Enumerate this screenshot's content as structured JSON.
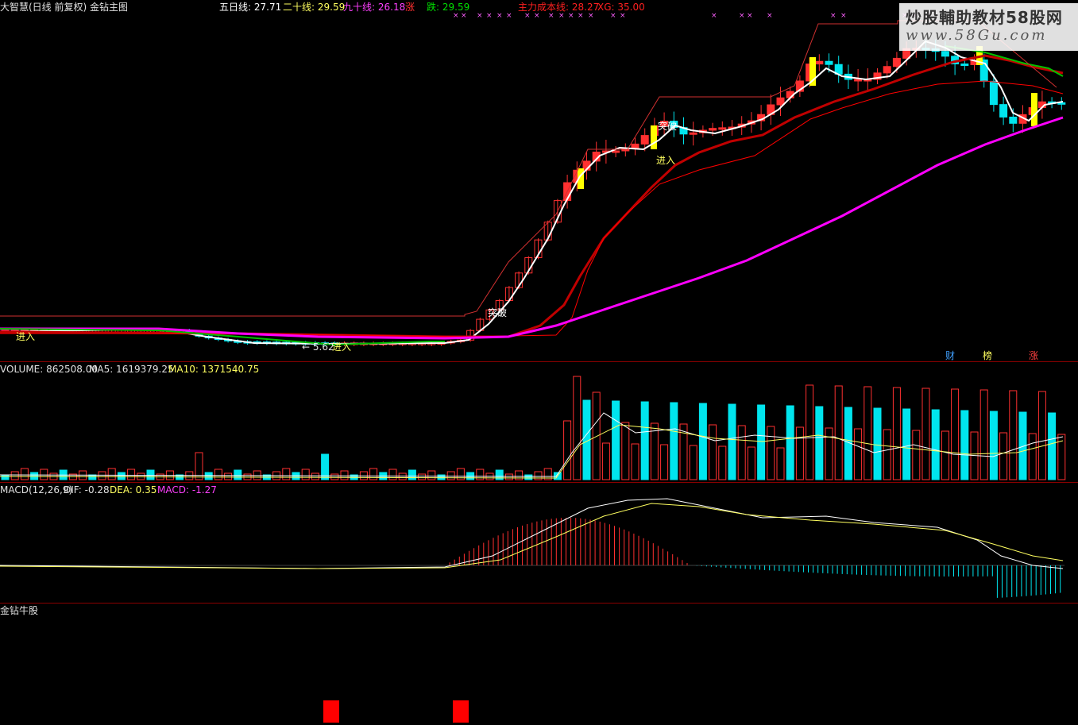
{
  "header": {
    "title": "大智慧(日线 前复权) 金钻主图",
    "ma5": "五日线: 27.71",
    "ma20": "二十线: 29.59",
    "ma90": "九十线: 26.18",
    "ma90_tag": "涨",
    "drop": "跌: 29.59",
    "cost": "主力成本线: 28.27",
    "xg": "XG: 35.00"
  },
  "main_annotations": {
    "enter1": "进入",
    "enter2": "进入",
    "enter3": "进入",
    "low_arrow": "← 5.62",
    "breakthrough1": "突破",
    "breakthrough2": "突破",
    "tag_cai": "财",
    "tag_bang": "榜",
    "tag_zhang": "涨"
  },
  "volume_header": {
    "volume": "VOLUME: 862508.00",
    "ma5": "MA5: 1619379.25",
    "ma10": "MA10: 1371540.75"
  },
  "macd_header": {
    "name": "MACD(12,26,9)",
    "dif": "DIF: -0.28",
    "dea": "DEA: 0.35",
    "macd": "MACD: -1.27"
  },
  "bottom_header": {
    "name": "金钻牛股"
  },
  "watermark": {
    "title": "炒股輔助教材58股网",
    "url": "www.58Gu.com"
  },
  "colors": {
    "up": "#ff3030",
    "down": "#00e5ee",
    "ma5": "#ffffff",
    "ma20": "#c00000",
    "ma90": "#ff00ff",
    "cost": "#ff0000",
    "green": "#00c000",
    "yellow": "#ffff00"
  },
  "chart_data": [
    {
      "type": "candlestick",
      "title": "大智慧(日线 前复权) 金钻主图",
      "series": [
        {
          "name": "五日线",
          "last": 27.71
        },
        {
          "name": "二十线",
          "last": 29.59
        },
        {
          "name": "九十线",
          "last": 26.18
        },
        {
          "name": "主力成本线",
          "last": 28.27
        }
      ],
      "annotations": [
        "进入",
        "突破",
        "财",
        "榜",
        "涨",
        "5.62"
      ]
    },
    {
      "type": "bar",
      "title": "VOLUME",
      "series": [
        {
          "name": "VOLUME",
          "last": 862508.0
        },
        {
          "name": "MA5",
          "last": 1619379.25
        },
        {
          "name": "MA10",
          "last": 1371540.75
        }
      ]
    },
    {
      "type": "line",
      "title": "MACD(12,26,9)",
      "series": [
        {
          "name": "DIF",
          "last": -0.28
        },
        {
          "name": "DEA",
          "last": 0.35
        },
        {
          "name": "MACD",
          "last": -1.27
        }
      ]
    }
  ]
}
